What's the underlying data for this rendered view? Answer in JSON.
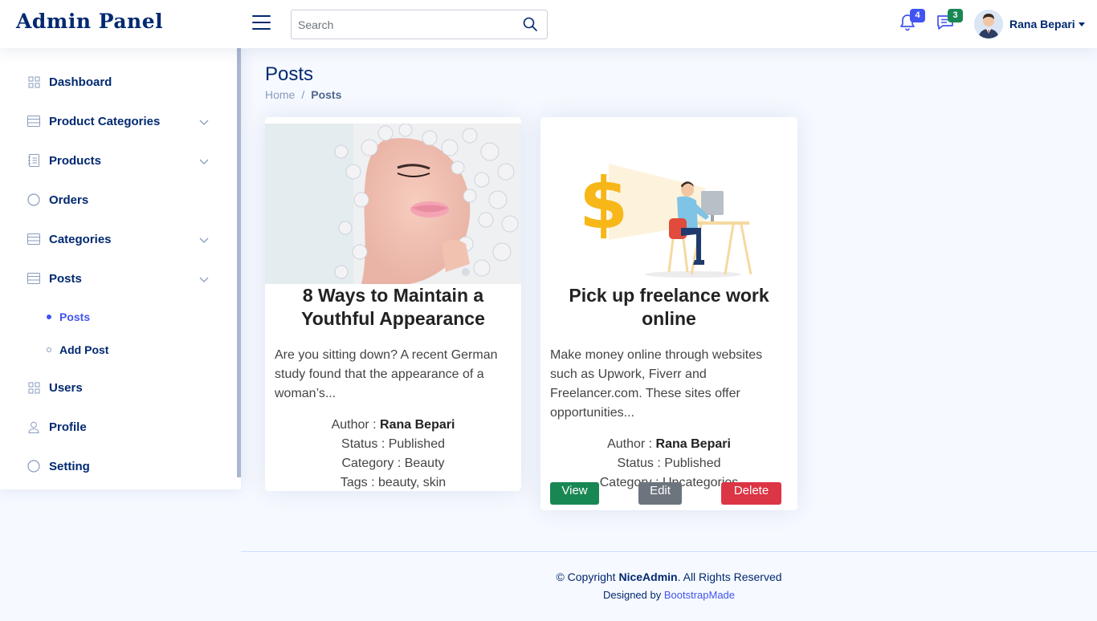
{
  "header": {
    "logo": "Admin Panel",
    "search_placeholder": "Search",
    "notifications_count": "4",
    "messages_count": "3",
    "user_name": "Rana Bepari"
  },
  "sidebar": {
    "items": [
      {
        "label": "Dashboard",
        "icon": "grid-icon"
      },
      {
        "label": "Product Categories",
        "icon": "layout-icon"
      },
      {
        "label": "Products",
        "icon": "journal-icon"
      },
      {
        "label": "Orders",
        "icon": "circle-icon"
      },
      {
        "label": "Categories",
        "icon": "layout-icon"
      },
      {
        "label": "Posts",
        "icon": "layout-icon"
      },
      {
        "label": "Users",
        "icon": "grid-icon"
      },
      {
        "label": "Profile",
        "icon": "person-icon"
      },
      {
        "label": "Setting",
        "icon": "circle-icon"
      }
    ],
    "posts_sub": [
      {
        "label": "Posts",
        "active": true
      },
      {
        "label": "Add Post",
        "active": false
      }
    ]
  },
  "main": {
    "title": "Posts",
    "breadcrumb": {
      "home": "Home",
      "separator": "/",
      "current": "Posts"
    }
  },
  "posts": [
    {
      "title": "8 Ways to Maintain a Youthful Appearance",
      "excerpt": "Are you sitting down? A recent German study found that the appearance of a woman’s...",
      "author_label": "Author : ",
      "author": "Rana Bepari",
      "status": "Status : Published",
      "category": "Category : Beauty",
      "tags": "Tags : beauty, skin"
    },
    {
      "title": "Pick up freelance work online",
      "excerpt": "Make money online through websites such as Upwork, Fiverr and Freelancer.com. These sites offer opportunities...",
      "author_label": "Author : ",
      "author": "Rana Bepari",
      "status": "Status : Published",
      "category": "Category : Uncategories",
      "buttons": {
        "view": "View",
        "edit": "Edit",
        "delete": "Delete"
      }
    }
  ],
  "footer": {
    "copyright_prefix": "© Copyright ",
    "brand": "NiceAdmin",
    "copyright_suffix": ". All Rights Reserved",
    "designed_by": "Designed by ",
    "designer": "BootstrapMade"
  },
  "colors": {
    "primary": "#012970",
    "accent": "#4154f1",
    "success": "#198754",
    "secondary": "#6c757d",
    "danger": "#dc3545",
    "background": "#f6f9ff"
  }
}
